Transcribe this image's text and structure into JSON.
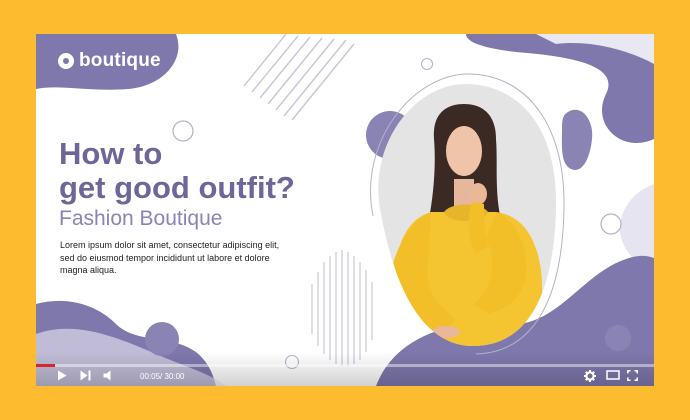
{
  "brand": {
    "logo_text": "boutique"
  },
  "headline": {
    "line1": "How to",
    "line2": "get good outfit?"
  },
  "subtitle": "Fashion Boutique",
  "description": "Lorem ipsum dolor sit amet, consectetur adipiscing elit, sed do eiusmod tempor incididunt ut labore et dolore magna aliqua.",
  "player": {
    "progress": 0.03,
    "time_display": "00:05/ 30:00",
    "icons": {
      "play": "play-icon",
      "next": "next-icon",
      "volume": "volume-icon",
      "settings": "gear-icon",
      "theater": "theater-mode-icon",
      "fullscreen": "fullscreen-icon"
    }
  },
  "colors": {
    "border": "#fdbb2f",
    "accent": "#7f78ad",
    "accent_dark": "#6d6699",
    "sweater": "#f4c531",
    "progress": "#d9262d"
  }
}
